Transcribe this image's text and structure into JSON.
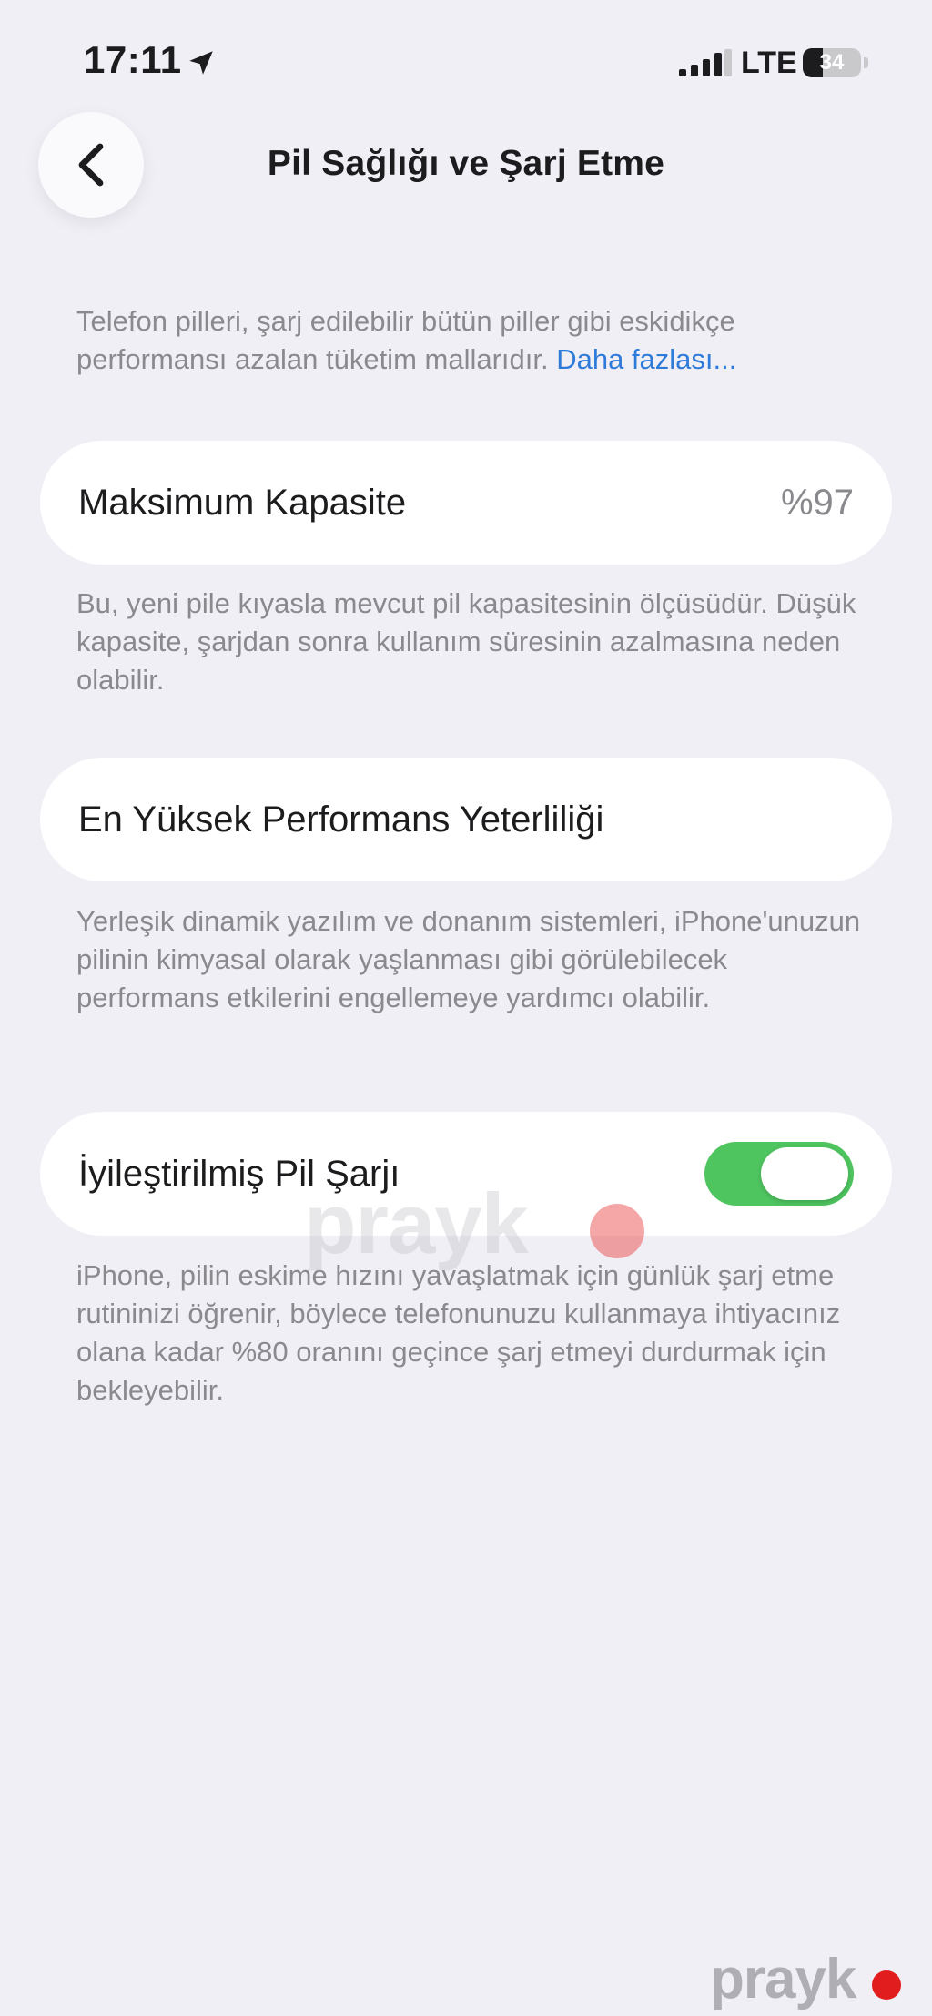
{
  "status_bar": {
    "time": "17:11",
    "network": "LTE",
    "battery_level": "34",
    "battery_fraction": 0.34
  },
  "icons": {
    "location": "location-arrow-icon",
    "signal": "cellular-signal-icon",
    "battery": "battery-icon",
    "back": "chevron-left-icon"
  },
  "nav": {
    "title": "Pil Sağlığı ve Şarj Etme"
  },
  "intro": {
    "text": "Telefon pilleri, şarj edilebilir bütün piller gibi eskidikçe performansı azalan tüketim mallarıdır. ",
    "link": "Daha fazlası..."
  },
  "capacity": {
    "label": "Maksimum Kapasite",
    "value": "%97",
    "footnote": "Bu, yeni pile kıyasla mevcut pil kapasitesinin ölçüsüdür. Düşük kapasite, şarjdan sonra kullanım süresinin azalmasına neden olabilir."
  },
  "performance": {
    "label": "En Yüksek Performans Yeterliliği",
    "footnote": "Yerleşik dinamik yazılım ve donanım sistemleri, iPhone'unuzun pilinin kimyasal olarak yaşlanması gibi görülebilecek performans etkilerini engellemeye yardımcı olabilir."
  },
  "optimized_charging": {
    "label": "İyileştirilmiş Pil Şarjı",
    "enabled": true,
    "footnote": "iPhone, pilin eskime hızını yavaşlatmak için günlük şarj etme rutininizi öğrenir, böylece telefonunuzu kullanmaya ihtiyacınız olana kadar %80 oranını geçince şarj etmeyi durdurmak için bekleyebilir."
  },
  "watermark": {
    "text": "prayk"
  },
  "colors": {
    "background": "#f0eff5",
    "card": "#ffffff",
    "secondary_text": "#8a8a8e",
    "link": "#2f7bd9",
    "toggle_on": "#4fc560",
    "watermark_dot": "#e11d1d"
  }
}
